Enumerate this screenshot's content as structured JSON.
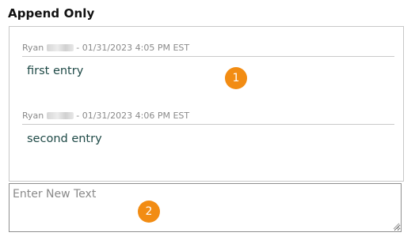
{
  "field": {
    "title": "Append Only"
  },
  "entries": [
    {
      "author_first": "Ryan",
      "meta_suffix": "- 01/31/2023 4:05 PM EST",
      "text": "first entry"
    },
    {
      "author_first": "Ryan",
      "meta_suffix": "- 01/31/2023 4:06 PM EST",
      "text": "second entry"
    }
  ],
  "new_text": {
    "placeholder": "Enter New Text",
    "value": ""
  },
  "callouts": [
    "1",
    "2"
  ],
  "colors": {
    "callout": "#f28c13",
    "entry_text": "#1f4a47",
    "meta_text": "#8a8a8a"
  }
}
